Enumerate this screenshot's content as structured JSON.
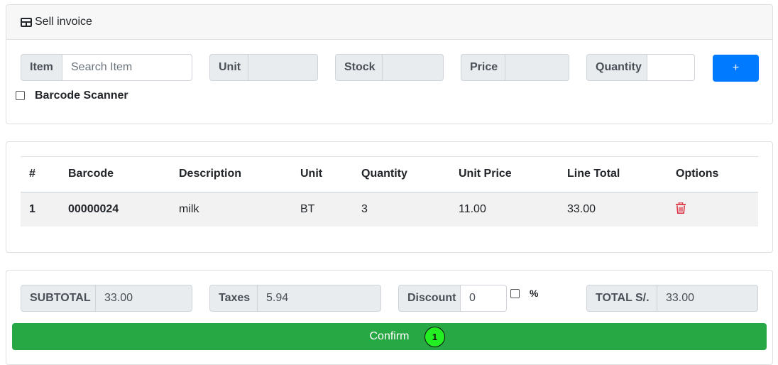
{
  "header": {
    "title": "Sell invoice",
    "icon": "table-icon"
  },
  "item_entry": {
    "item_label": "Item",
    "item_placeholder": "Search Item",
    "unit_label": "Unit",
    "unit_value": "",
    "stock_label": "Stock",
    "stock_value": "",
    "price_label": "Price",
    "price_value": "",
    "quantity_label": "Quantity",
    "quantity_value": "",
    "add_label": "+",
    "barcode_scanner_label": "Barcode Scanner"
  },
  "table": {
    "columns": [
      "#",
      "Barcode",
      "Description",
      "Unit",
      "Quantity",
      "Unit Price",
      "Line Total",
      "Options"
    ],
    "rows": [
      {
        "index": "1",
        "barcode": "00000024",
        "description": "milk",
        "unit": "BT",
        "quantity": "3",
        "unit_price": "11.00",
        "line_total": "33.00"
      }
    ]
  },
  "totals": {
    "subtotal_label": "SUBTOTAL",
    "subtotal_value": "33.00",
    "taxes_label": "Taxes",
    "taxes_value": "5.94",
    "discount_label": "Discount",
    "discount_value": "0",
    "percent_label": "%",
    "total_label": "TOTAL S/.",
    "total_value": "33.00"
  },
  "confirm": {
    "label": "Confirm",
    "badge": "1"
  },
  "colors": {
    "primary": "#007bff",
    "success": "#28a745",
    "danger": "#dc3545",
    "badge": "#22ee22"
  }
}
